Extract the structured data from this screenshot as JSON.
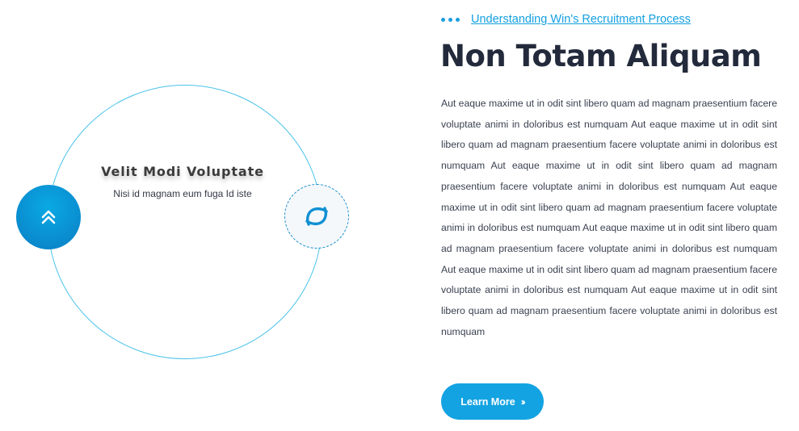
{
  "feature": {
    "title": "Velit Modi Voluptate",
    "subtitle": "Nisi id magnam eum fuga Id iste",
    "left_icon": "double-chevron-up-icon",
    "right_icon": "swirl-logo-icon",
    "accent_color": "#0a8fd1"
  },
  "content": {
    "eyebrow_link": "Understanding Win's Recruitment Process",
    "heading": "Non Totam Aliquam",
    "paragraph": "Aut eaque maxime ut in odit sint libero quam ad magnam praesentium facere voluptate animi in doloribus est numquam Aut eaque maxime ut in odit sint libero quam ad magnam praesentium facere voluptate animi in doloribus est numquam Aut eaque maxime ut in odit sint libero quam ad magnam praesentium facere voluptate animi in doloribus est numquam Aut eaque maxime ut in odit sint libero quam ad magnam praesentium facere voluptate animi in doloribus est numquam Aut eaque maxime ut in odit sint libero quam ad magnam praesentium facere voluptate animi in doloribus est numquam Aut eaque maxime ut in odit sint libero quam ad magnam praesentium facere voluptate animi in doloribus est numquam Aut eaque maxime ut in odit sint libero quam ad magnam praesentium facere voluptate animi in doloribus est numquam",
    "cta_label": "Learn More",
    "cta_icon": "double-chevron-right-icon",
    "brand_color": "#13a3e2"
  }
}
